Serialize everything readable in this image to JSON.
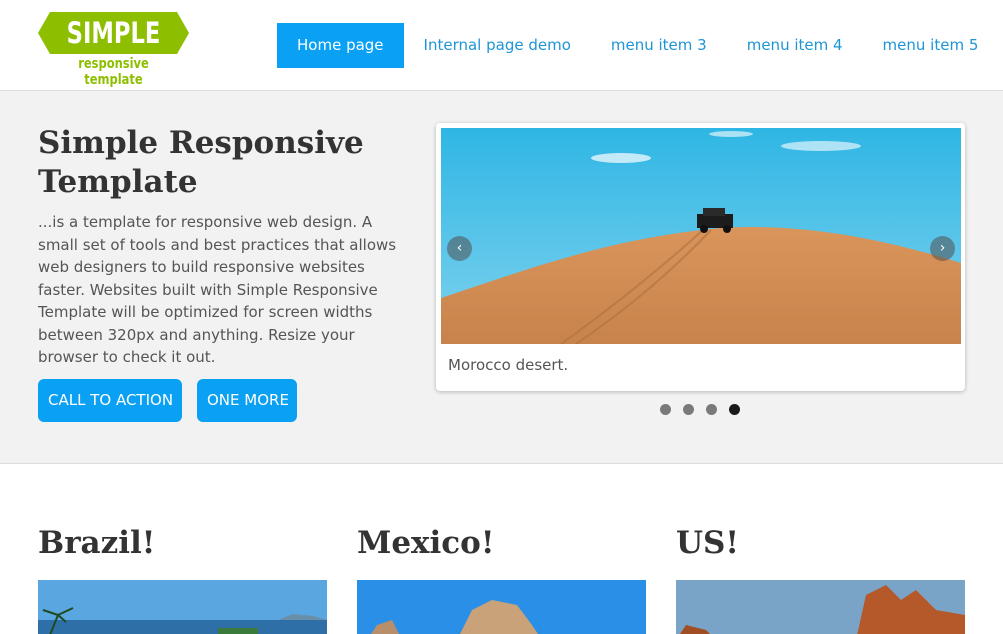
{
  "logo": {
    "title": "SIMPLE",
    "subtitle": "responsive template",
    "color": "#8dbf00"
  },
  "nav": {
    "items": [
      {
        "label": "Home page",
        "active": true
      },
      {
        "label": "Internal page demo",
        "active": false
      },
      {
        "label": "menu item 3",
        "active": false
      },
      {
        "label": "menu item 4",
        "active": false
      },
      {
        "label": "menu item 5",
        "active": false
      }
    ],
    "accent": "#0aa0f4"
  },
  "hero": {
    "title": "Simple Responsive Template",
    "text": "...is a template for responsive web design. A small set of tools and best practices that allows web designers to build responsive websites faster. Websites built with Simple Responsive Template will be optimized for screen widths between 320px and anything. Resize your browser to check it out.",
    "buttons": [
      "CALL TO ACTION",
      "ONE MORE"
    ]
  },
  "slider": {
    "caption": "Morocco desert.",
    "prev_icon": "chevron-left-icon",
    "next_icon": "chevron-right-icon",
    "slide_count": 4,
    "active_slide": 4
  },
  "cards": [
    {
      "title": "Brazil!"
    },
    {
      "title": "Mexico!"
    },
    {
      "title": "US!"
    }
  ]
}
